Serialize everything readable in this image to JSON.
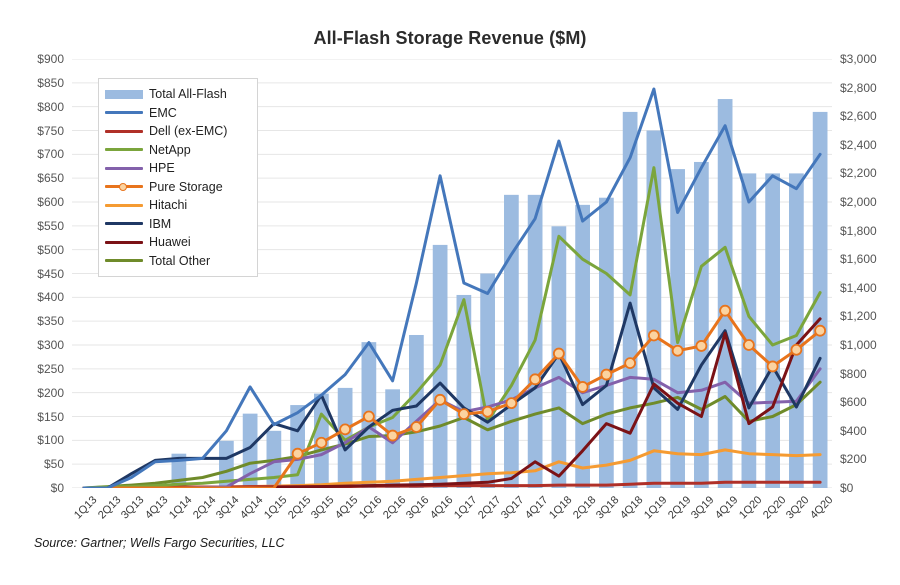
{
  "chart_data": {
    "type": "bar",
    "title": "All-Flash Storage Revenue ($M)",
    "source": "Source: Gartner; Wells Fargo Securities, LLC",
    "xlabel": "",
    "ylabel": "",
    "grid": true,
    "legend_position": "top-left-inside",
    "categories": [
      "1Q13",
      "2Q13",
      "3Q13",
      "4Q13",
      "1Q14",
      "2Q14",
      "3Q14",
      "4Q14",
      "1Q15",
      "2Q15",
      "3Q15",
      "4Q15",
      "1Q16",
      "2Q16",
      "3Q16",
      "4Q16",
      "1Q17",
      "2Q17",
      "3Q17",
      "4Q17",
      "1Q18",
      "2Q18",
      "3Q18",
      "4Q18",
      "1Q19",
      "2Q19",
      "3Q19",
      "4Q19",
      "1Q20",
      "2Q20",
      "3Q20",
      "4Q20"
    ],
    "left_axis": {
      "label": "",
      "ticks": [
        "$0",
        "$50",
        "$100",
        "$150",
        "$200",
        "$250",
        "$300",
        "$350",
        "$400",
        "$450",
        "$500",
        "$550",
        "$600",
        "$650",
        "$700",
        "$750",
        "$800",
        "$850",
        "$900"
      ],
      "values": [
        0,
        50,
        100,
        150,
        200,
        250,
        300,
        350,
        400,
        450,
        500,
        550,
        600,
        650,
        700,
        750,
        800,
        850,
        900
      ],
      "ylim": [
        0,
        900
      ]
    },
    "right_axis": {
      "label": "",
      "ticks": [
        "$0",
        "$200",
        "$400",
        "$600",
        "$800",
        "$1,000",
        "$1,200",
        "$1,400",
        "$1,600",
        "$1,800",
        "$2,000",
        "$2,200",
        "$2,400",
        "$2,600",
        "$2,800",
        "$3,000"
      ],
      "values": [
        0,
        200,
        400,
        600,
        800,
        1000,
        1200,
        1400,
        1600,
        1800,
        2000,
        2200,
        2400,
        2600,
        2800,
        3000
      ],
      "ylim": [
        0,
        3000
      ]
    },
    "bar_series": {
      "name": "Total All-Flash",
      "axis": "right",
      "color": "#9cbbe0",
      "values_right_axis": [
        0,
        0,
        0,
        0,
        240,
        0,
        330,
        520,
        400,
        580,
        660,
        700,
        1020,
        690,
        1070,
        1700,
        1350,
        1500,
        2050,
        2050,
        1830,
        1980,
        2030,
        2630,
        2500,
        2230,
        2280,
        2720,
        2200,
        2200,
        2200,
        2630
      ],
      "values_left_axis_equivalent": [
        0,
        0,
        0,
        0,
        72,
        0,
        99,
        156,
        120,
        174,
        198,
        210,
        306,
        207,
        321,
        510,
        405,
        450,
        615,
        615,
        549,
        594,
        609,
        789,
        750,
        669,
        684,
        816,
        660,
        660,
        660,
        789
      ]
    },
    "line_series": [
      {
        "name": "EMC",
        "color": "#4477bb",
        "axis": "left",
        "marker": false,
        "values": [
          0,
          0,
          22,
          55,
          58,
          62,
          120,
          212,
          133,
          158,
          195,
          238,
          305,
          225,
          430,
          655,
          430,
          408,
          490,
          565,
          728,
          560,
          600,
          693,
          837,
          578,
          672,
          760,
          600,
          655,
          628,
          700
        ]
      },
      {
        "name": "Dell (ex-EMC)",
        "color": "#b03028",
        "axis": "left",
        "marker": false,
        "values": [
          0,
          0,
          0,
          0,
          2,
          2,
          2,
          3,
          3,
          3,
          3,
          3,
          4,
          4,
          4,
          5,
          5,
          5,
          5,
          5,
          6,
          6,
          6,
          8,
          10,
          10,
          10,
          12,
          12,
          12,
          12,
          12
        ]
      },
      {
        "name": "NetApp",
        "color": "#7ba53c",
        "axis": "left",
        "marker": false,
        "values": [
          0,
          2,
          3,
          5,
          8,
          10,
          14,
          18,
          22,
          28,
          155,
          100,
          128,
          148,
          200,
          258,
          395,
          140,
          215,
          310,
          528,
          480,
          450,
          405,
          672,
          305,
          465,
          505,
          360,
          300,
          320,
          410
        ]
      },
      {
        "name": "HPE",
        "color": "#8361ab",
        "axis": "left",
        "marker": false,
        "values": [
          0,
          0,
          0,
          0,
          0,
          1,
          2,
          30,
          55,
          60,
          70,
          95,
          128,
          95,
          140,
          185,
          160,
          170,
          185,
          210,
          232,
          200,
          215,
          232,
          228,
          200,
          205,
          222,
          178,
          180,
          182,
          250
        ]
      },
      {
        "name": "Pure Storage",
        "color": "#e8741c",
        "axis": "left",
        "marker": true,
        "values": [
          0,
          0,
          0,
          0,
          0,
          0,
          0,
          0,
          0,
          72,
          95,
          123,
          150,
          110,
          128,
          185,
          155,
          160,
          178,
          228,
          282,
          212,
          238,
          262,
          320,
          288,
          298,
          372,
          300,
          255,
          290,
          330
        ]
      },
      {
        "name": "Hitachi",
        "color": "#f59b32",
        "axis": "left",
        "marker": false,
        "values": [
          0,
          0,
          0,
          0,
          0,
          1,
          2,
          3,
          4,
          5,
          7,
          10,
          12,
          14,
          18,
          22,
          26,
          30,
          32,
          36,
          55,
          42,
          48,
          58,
          78,
          72,
          70,
          80,
          72,
          70,
          68,
          70
        ]
      },
      {
        "name": "IBM",
        "color": "#1f3864",
        "axis": "left",
        "marker": false,
        "values": [
          0,
          0,
          30,
          58,
          62,
          62,
          62,
          85,
          135,
          120,
          195,
          80,
          128,
          163,
          172,
          220,
          168,
          138,
          175,
          210,
          282,
          175,
          215,
          388,
          210,
          165,
          258,
          330,
          168,
          255,
          170,
          272
        ]
      },
      {
        "name": "Huawei",
        "color": "#7b1216",
        "axis": "left",
        "marker": false,
        "values": [
          0,
          0,
          0,
          0,
          0,
          0,
          0,
          0,
          1,
          2,
          3,
          4,
          5,
          6,
          7,
          8,
          10,
          12,
          20,
          55,
          25,
          78,
          135,
          115,
          218,
          178,
          150,
          325,
          135,
          170,
          300,
          355
        ]
      },
      {
        "name": "Total Other",
        "color": "#6f8b2a",
        "axis": "left",
        "marker": false,
        "values": [
          0,
          3,
          6,
          10,
          16,
          22,
          35,
          52,
          58,
          66,
          80,
          92,
          108,
          110,
          118,
          130,
          148,
          122,
          140,
          155,
          168,
          135,
          155,
          168,
          178,
          190,
          165,
          192,
          140,
          150,
          175,
          222
        ]
      }
    ]
  }
}
